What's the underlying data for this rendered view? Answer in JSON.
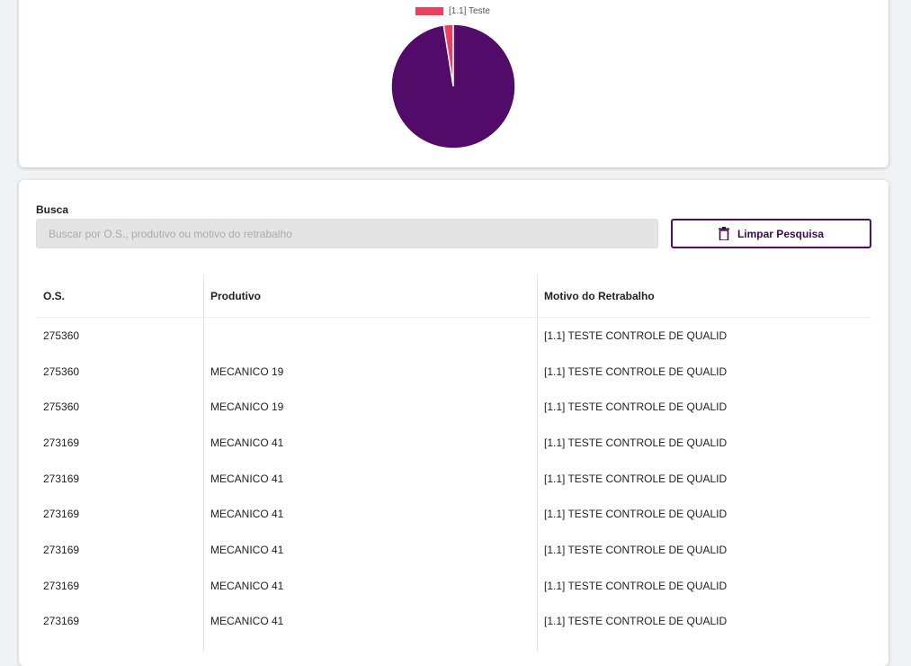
{
  "chart": {
    "legend_label": "[1.1] Teste",
    "colors": {
      "slice_main": "#520b69",
      "slice_minor": "#e9405f"
    }
  },
  "chart_data": {
    "type": "pie",
    "labels": [
      "[1.1] Teste",
      ""
    ],
    "values": [
      2.5,
      97.5
    ],
    "legend": "top"
  },
  "search": {
    "label": "Busca",
    "placeholder": "Buscar por O.S., produtivo ou motivo do retrabalho",
    "value": "",
    "clear_button_label": "Limpar Pesquisa",
    "clear_icon": "trash-icon"
  },
  "table": {
    "columns": [
      "O.S.",
      "Produtivo",
      "Motivo do Retrabalho"
    ],
    "rows": [
      {
        "os": "275360",
        "produtivo": "",
        "motivo": "[1.1] TESTE CONTROLE DE QUALID"
      },
      {
        "os": "275360",
        "produtivo": "MECANICO 19",
        "motivo": "[1.1] TESTE CONTROLE DE QUALID"
      },
      {
        "os": "275360",
        "produtivo": "MECANICO 19",
        "motivo": "[1.1] TESTE CONTROLE DE QUALID"
      },
      {
        "os": "273169",
        "produtivo": "MECANICO 41",
        "motivo": "[1.1] TESTE CONTROLE DE QUALID"
      },
      {
        "os": "273169",
        "produtivo": "MECANICO 41",
        "motivo": "[1.1] TESTE CONTROLE DE QUALID"
      },
      {
        "os": "273169",
        "produtivo": "MECANICO 41",
        "motivo": "[1.1] TESTE CONTROLE DE QUALID"
      },
      {
        "os": "273169",
        "produtivo": "MECANICO 41",
        "motivo": "[1.1] TESTE CONTROLE DE QUALID"
      },
      {
        "os": "273169",
        "produtivo": "MECANICO 41",
        "motivo": "[1.1] TESTE CONTROLE DE QUALID"
      },
      {
        "os": "273169",
        "produtivo": "MECANICO 41",
        "motivo": "[1.1] TESTE CONTROLE DE QUALID"
      }
    ]
  }
}
